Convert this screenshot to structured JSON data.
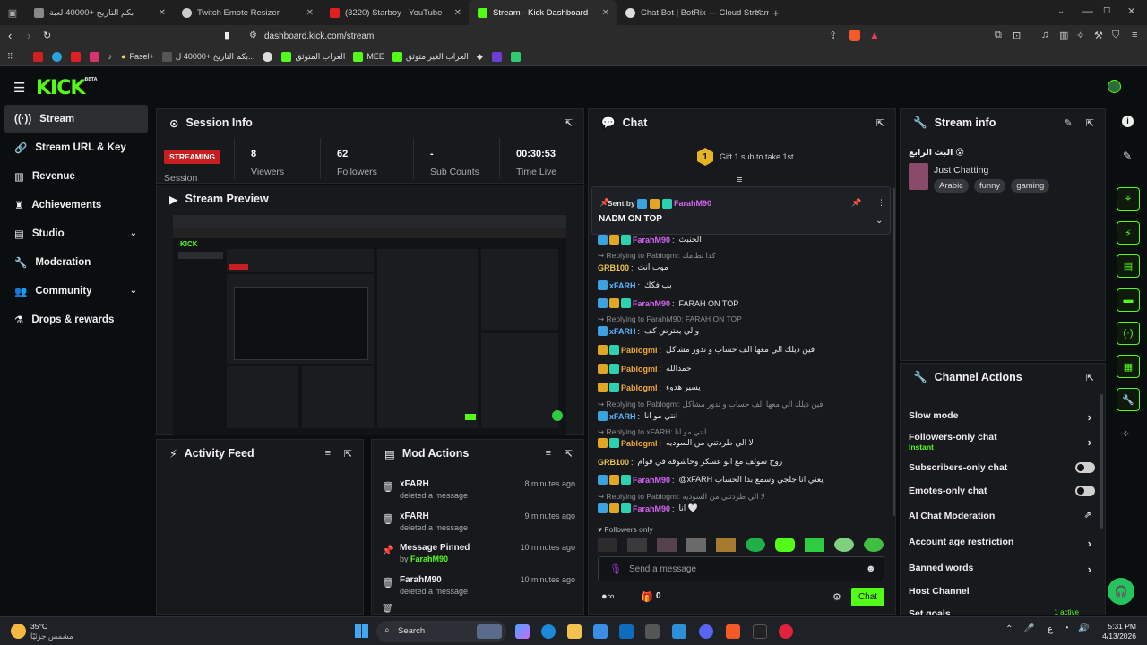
{
  "browser": {
    "tabs": [
      {
        "label": "بكم التاريخ +40000 لعبة"
      },
      {
        "label": "Twitch Emote Resizer"
      },
      {
        "label": "(3220) Starboy - YouTube"
      },
      {
        "label": "Stream - Kick Dashboard"
      },
      {
        "label": "Chat Bot | BotRix — Cloud Streaming"
      }
    ],
    "url": "dashboard.kick.com/stream",
    "bookmarks": [
      "Fasel+",
      "بكم التاريخ +40000 ل...",
      "العراب المتوثق",
      "MEE",
      "العراب الغير متوثق"
    ]
  },
  "app": {
    "logo": "KICK",
    "logo_sup": "BETA"
  },
  "sidebar": {
    "items": [
      {
        "label": "Stream",
        "icon": "stream-icon"
      },
      {
        "label": "Stream URL & Key",
        "icon": "link-icon"
      },
      {
        "label": "Revenue",
        "icon": "chart-icon"
      },
      {
        "label": "Achievements",
        "icon": "trophy-icon"
      },
      {
        "label": "Studio",
        "icon": "studio-icon"
      },
      {
        "label": "Moderation",
        "icon": "wrench-icon"
      },
      {
        "label": "Community",
        "icon": "community-icon"
      },
      {
        "label": "Drops & rewards",
        "icon": "drops-icon"
      }
    ]
  },
  "session": {
    "title": "Session Info",
    "status": "STREAMING",
    "session_label": "Session",
    "stats": [
      {
        "value": "8",
        "label": "Viewers"
      },
      {
        "value": "62",
        "label": "Followers"
      },
      {
        "value": "-",
        "label": "Sub Counts"
      },
      {
        "value": "00:30:53",
        "label": "Time Live"
      }
    ]
  },
  "preview": {
    "title": "Stream Preview"
  },
  "activity": {
    "title": "Activity Feed"
  },
  "mod": {
    "title": "Mod Actions",
    "items": [
      {
        "title": "xFARH",
        "sub": "deleted a message",
        "time": "8 minutes ago"
      },
      {
        "title": "xFARH",
        "sub": "deleted a message",
        "time": "9 minutes ago"
      },
      {
        "title": "Message Pinned",
        "sub_prefix": "by",
        "sub_user": "FarahM90",
        "time": "10 minutes ago"
      },
      {
        "title": "FarahM90",
        "sub": "deleted a message",
        "time": "10 minutes ago"
      }
    ]
  },
  "chat": {
    "title": "Chat",
    "gift_count": "1",
    "gift_text": "Gift 1 sub to take 1st",
    "pinned_sent_by": "Sent by",
    "pinned_user": "FarahM90",
    "pinned_text": "NADM ON TOP",
    "messages": [
      {
        "type": "msg",
        "user": "FarahM90",
        "color": "#d764f4",
        "text": "الجنبث"
      },
      {
        "type": "reply",
        "text": "Replying to Pablogml: كذا نطامك"
      },
      {
        "type": "msg",
        "user": "GRB100",
        "color": "#f2c94c",
        "text": "موب انت"
      },
      {
        "type": "msg",
        "user": "xFARH",
        "color": "#59b8ff",
        "text": "يب فكك"
      },
      {
        "type": "msg",
        "user": "FarahM90",
        "color": "#d764f4",
        "text": "FARAH ON TOP"
      },
      {
        "type": "reply",
        "text": "Replying to FarahM90: FARAH ON TOP"
      },
      {
        "type": "msg",
        "user": "xFARH",
        "color": "#59b8ff",
        "text": "والي يعترض كف"
      },
      {
        "type": "msg",
        "user": "Pablogml",
        "color": "#f2a93b",
        "text": "فين ذيلك الي معها الف حساب و تدور مشاكل"
      },
      {
        "type": "msg",
        "user": "Pablogml",
        "color": "#f2a93b",
        "text": "حمدالله"
      },
      {
        "type": "msg",
        "user": "Pablogml",
        "color": "#f2a93b",
        "text": "يسير هدوء"
      },
      {
        "type": "reply",
        "text": "Replying to Pablogml: فين ذيلك الي معها الف حساب و تدور مشاكل"
      },
      {
        "type": "msg",
        "user": "xFARH",
        "color": "#59b8ff",
        "text": "انتي مو انا"
      },
      {
        "type": "reply",
        "text": "Replying to xFARH: انتي مو انا"
      },
      {
        "type": "msg",
        "user": "Pablogml",
        "color": "#f2a93b",
        "text": "لا الي طردتني من السوديه"
      },
      {
        "type": "msg",
        "user": "GRB100",
        "color": "#f2c94c",
        "text": "روح سولف مع ابو عسكر وخاشوقه في قوام"
      },
      {
        "type": "msg",
        "user": "FarahM90",
        "color": "#d764f4",
        "text": "@xFARH يعني انا جلجي وسمع بذا الحساب"
      },
      {
        "type": "reply",
        "text": "Replying to Pablogml: لا الي طردتني من السوديه"
      },
      {
        "type": "msg",
        "user": "FarahM90",
        "color": "#d764f4",
        "text": "انا 🤍"
      }
    ],
    "followers_only": "Followers only",
    "send_placeholder": "Send a message",
    "points": "0",
    "chat_button": "Chat"
  },
  "stream_info": {
    "title": "Stream info",
    "stream_title": "البث الرابع 😮",
    "category": "Just Chatting",
    "tags": [
      "Arabic",
      "funny",
      "gaming"
    ]
  },
  "channel_actions": {
    "title": "Channel Actions",
    "items": [
      {
        "label": "Slow mode",
        "control": "arrow"
      },
      {
        "label": "Followers-only chat",
        "sub": "Instant",
        "control": "arrow"
      },
      {
        "label": "Subscribers-only chat",
        "control": "toggle"
      },
      {
        "label": "Emotes-only chat",
        "control": "toggle"
      },
      {
        "label": "AI Chat Moderation",
        "control": "external"
      },
      {
        "label": "Account age restriction",
        "control": "arrow"
      },
      {
        "label": "Banned words",
        "control": "arrow"
      },
      {
        "label": "Host Channel",
        "control": "none"
      },
      {
        "label": "Set goals",
        "control": "arrow",
        "extra": "1 active"
      }
    ]
  },
  "taskbar": {
    "weather_temp": "35°C",
    "weather_text": "مشمس جزئيًا",
    "search": "Search",
    "time": "5:31 PM",
    "date": "4/13/2026",
    "lang": "ع"
  },
  "colors": {
    "accent": "#53fc18",
    "live": "#c71f1f",
    "panel": "#17191c"
  }
}
